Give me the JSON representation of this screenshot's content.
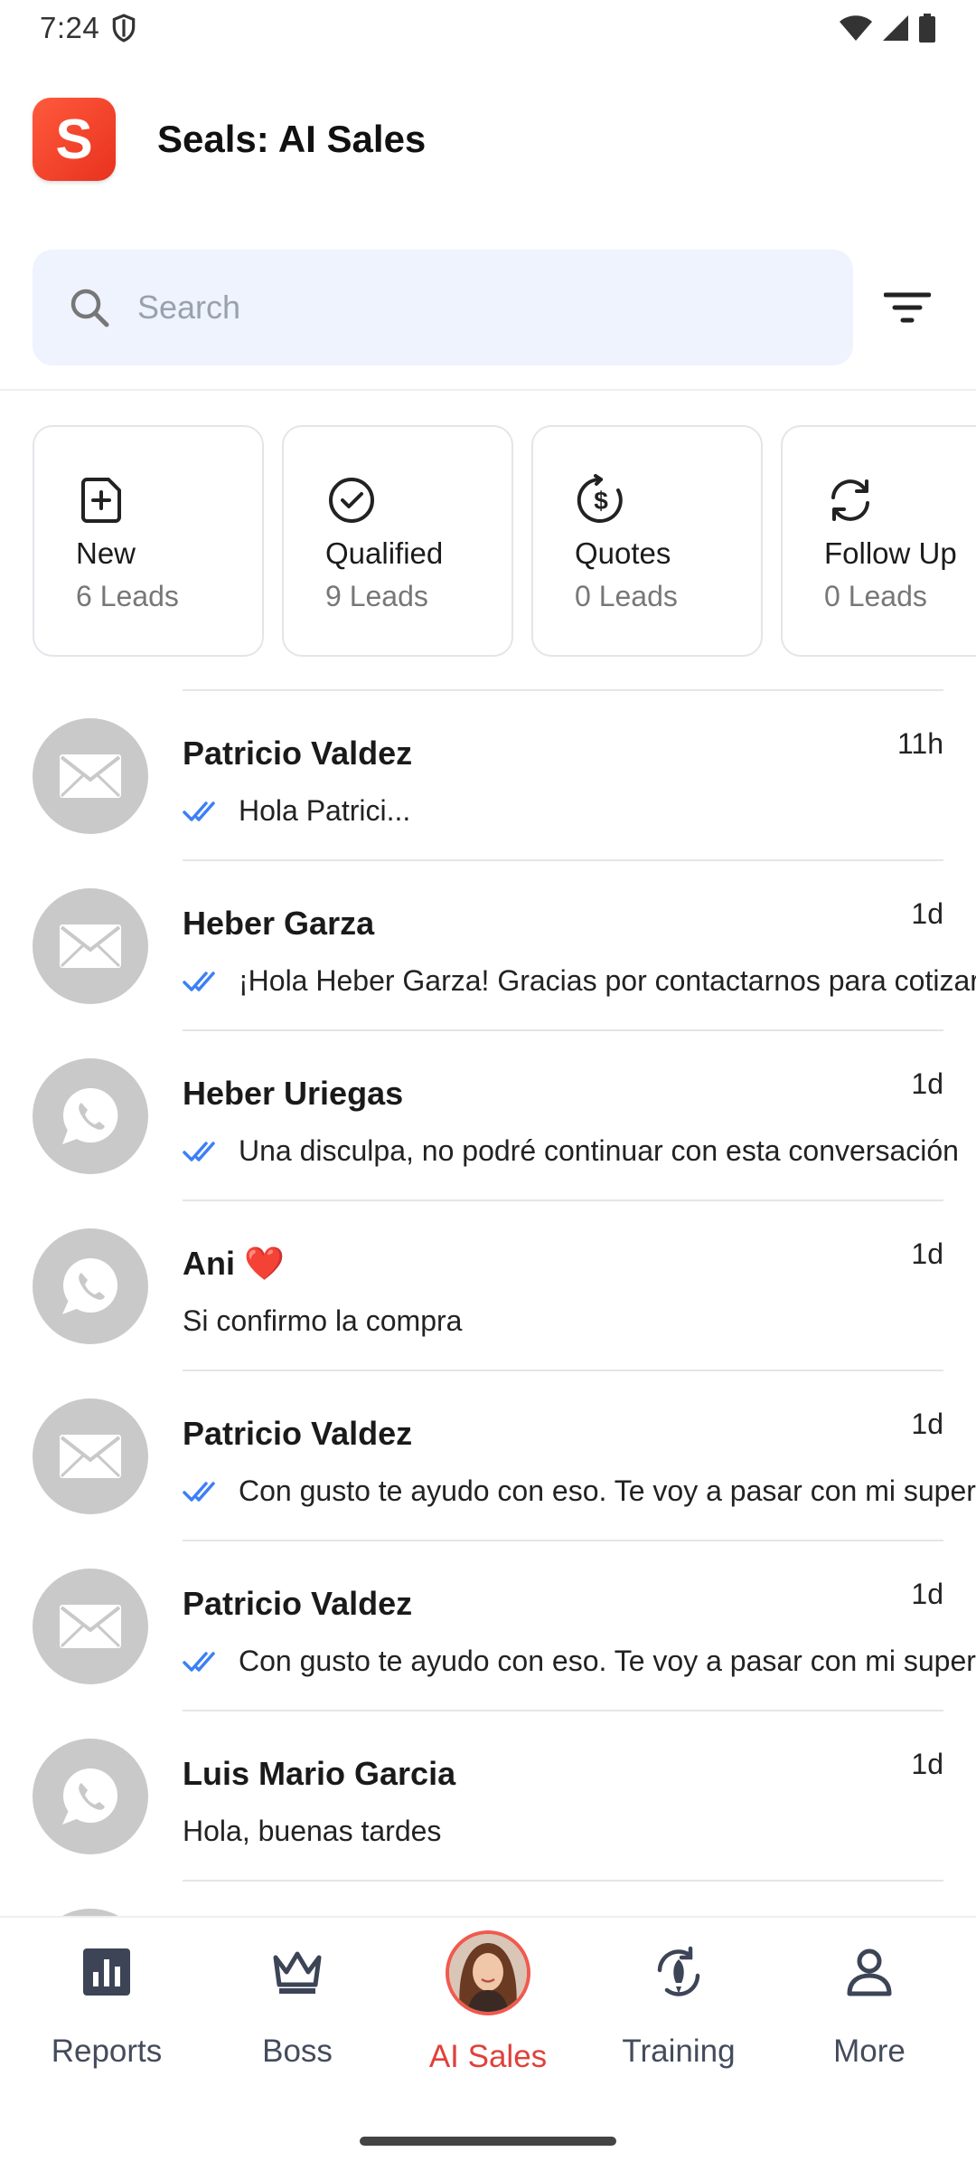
{
  "status_bar": {
    "time": "7:24"
  },
  "app": {
    "title": "Seals: AI Sales",
    "logo_letter": "S",
    "brand_color": "#ef4129"
  },
  "search": {
    "placeholder": "Search",
    "value": ""
  },
  "categories": [
    {
      "icon": "new-lead-icon",
      "label": "New",
      "count": "6 Leads"
    },
    {
      "icon": "check-circle-icon",
      "label": "Qualified",
      "count": "9 Leads"
    },
    {
      "icon": "dollar-cycle-icon",
      "label": "Quotes",
      "count": "0 Leads"
    },
    {
      "icon": "refresh-icon",
      "label": "Follow Up",
      "count": "0 Leads"
    }
  ],
  "conversations": [
    {
      "channel": "email",
      "name": "Patricio Valdez",
      "time": "11h",
      "read": true,
      "preview": "Hola Patrici..."
    },
    {
      "channel": "email",
      "name": "Heber Garza",
      "time": "1d",
      "read": true,
      "preview": "¡Hola Heber Garza! Gracias por contactarnos para cotizar"
    },
    {
      "channel": "whatsapp",
      "name": "Heber Uriegas",
      "time": "1d",
      "read": true,
      "preview": "Una disculpa, no podré continuar con esta conversación"
    },
    {
      "channel": "whatsapp",
      "name": "Ani ❤️",
      "time": "1d",
      "read": false,
      "preview": "Si confirmo la compra"
    },
    {
      "channel": "email",
      "name": "Patricio Valdez",
      "time": "1d",
      "read": true,
      "preview": "Con gusto te ayudo con eso. Te voy a pasar con mi supervisor"
    },
    {
      "channel": "email",
      "name": "Patricio Valdez",
      "time": "1d",
      "read": true,
      "preview": "Con gusto te ayudo con eso. Te voy a pasar con mi supervisor"
    },
    {
      "channel": "whatsapp",
      "name": "Luis Mario Garcia",
      "time": "1d",
      "read": false,
      "preview": "Hola, buenas tardes"
    }
  ],
  "nav": {
    "reports": "Reports",
    "boss": "Boss",
    "ai_sales": "AI Sales",
    "training": "Training",
    "more": "More",
    "active": "ai_sales",
    "active_color": "#e0413a"
  },
  "colors": {
    "read_tick": "#3d7ff5",
    "avatar_bg": "#c9c9c9",
    "search_bg": "#eef3fd"
  }
}
